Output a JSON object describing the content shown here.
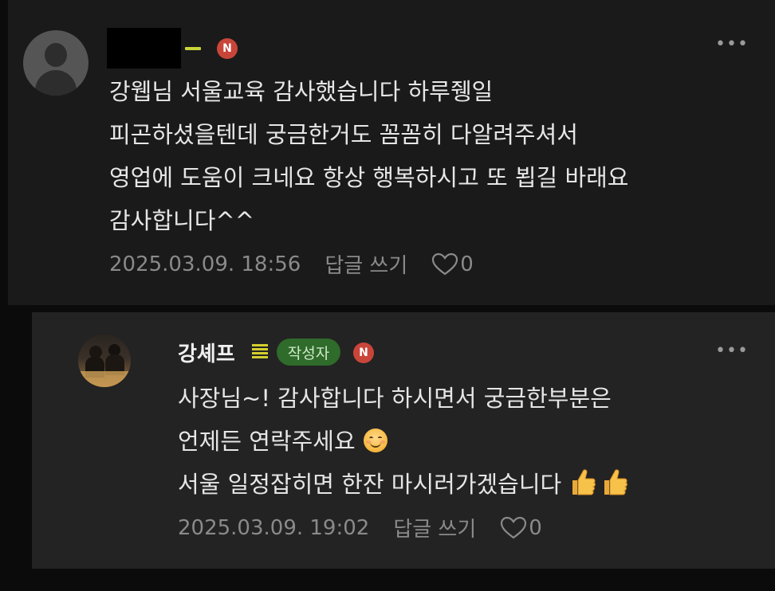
{
  "comments": [
    {
      "author": "",
      "badge": "N",
      "lines": [
        "강웹님 서울교육 감사했습니다 하루쥉일",
        "피곤하셨을텐데 궁금한거도 꼼꼼히 다알려주셔서",
        "영업에 도움이 크네요 항상 행복하시고 또 뵙길 바래요",
        "감사합니다^^"
      ],
      "date": "2025.03.09. 18:56",
      "reply_label": "답글 쓰기",
      "like_count": "0",
      "more_label": "•••"
    },
    {
      "author": "강셰프",
      "author_tag": "작성자",
      "badge": "N",
      "lines": [
        "사장님~! 감사합니다 하시면서 궁금한부분은",
        "언제든 연락주세요",
        "서울 일정잡히면 한잔 마시러가겠습니다"
      ],
      "line_emojis": [
        "",
        "smiling-face",
        "thumbs-up thumbs-up"
      ],
      "date": "2025.03.09. 19:02",
      "reply_label": "답글 쓰기",
      "like_count": "0",
      "more_label": "•••"
    }
  ],
  "colors": {
    "background": "#0b0b0b",
    "comment_bg": "#1a1a1a",
    "reply_bg": "#232323",
    "badge_red": "#c9453a",
    "author_tag_green": "#2f6b2a",
    "level_yellow": "#d4cf2e",
    "text": "#e6e6e6",
    "meta_text": "#8a8a8a"
  }
}
